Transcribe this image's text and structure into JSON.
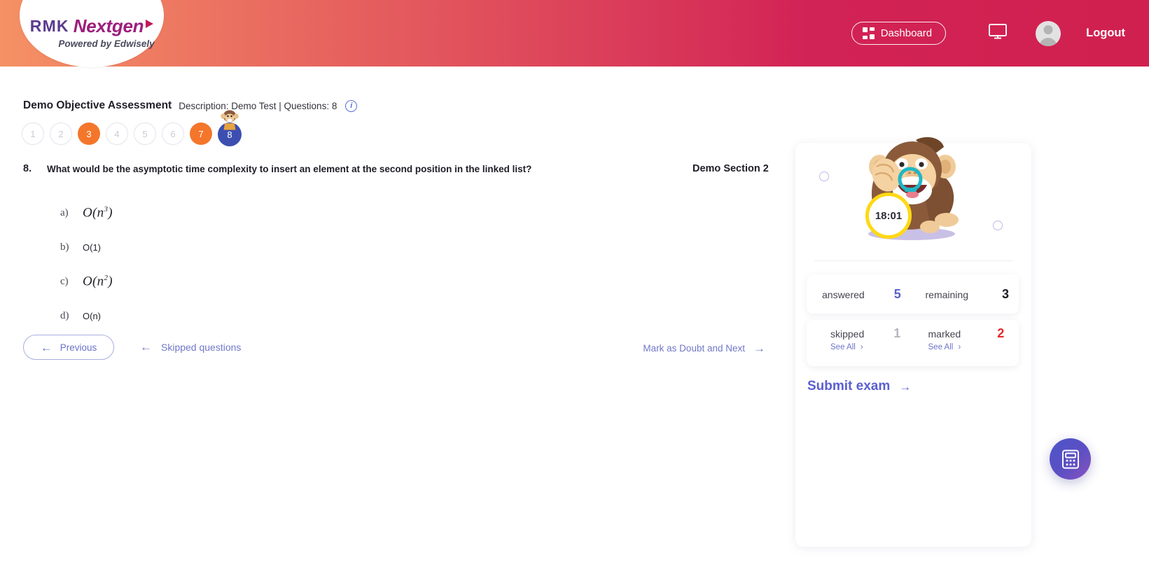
{
  "header": {
    "logo": {
      "prefix": "RMK",
      "brand": "Nextgen",
      "tagline": "Powered by Edwisely",
      "triangle_icon": "play-triangle-icon"
    },
    "dashboard_label": "Dashboard",
    "dashboard_icon": "grid-icon",
    "monitor_icon": "monitor-icon",
    "avatar_icon": "user-avatar-icon",
    "logout_label": "Logout",
    "gradient_from": "#f59164",
    "gradient_to": "#d0204f"
  },
  "assessment": {
    "title": "Demo Objective Assessment",
    "description": "Description: Demo Test | Questions: 8",
    "info_icon": "info-icon",
    "section_label": "Demo Section 2"
  },
  "question_nav": {
    "items": [
      {
        "label": "1",
        "state": "plain"
      },
      {
        "label": "2",
        "state": "plain"
      },
      {
        "label": "3",
        "state": "done"
      },
      {
        "label": "4",
        "state": "plain"
      },
      {
        "label": "5",
        "state": "plain"
      },
      {
        "label": "6",
        "state": "plain"
      },
      {
        "label": "7",
        "state": "done"
      },
      {
        "label": "8",
        "state": "current"
      }
    ],
    "mascot_icon": "monkey-mascot-icon",
    "colors": {
      "done": "#f4762a",
      "current": "#3c4fb0",
      "plain_border": "#e3e4ec"
    }
  },
  "question": {
    "number": "8.",
    "text": "What would be the asymptotic time complexity to insert an element at the second position in the linked list?",
    "options": [
      {
        "letter": "a)",
        "text": "O(n3)",
        "base": "O(n",
        "exp": "3",
        "close": ")",
        "style": "math"
      },
      {
        "letter": "b)",
        "text": "O(1)",
        "base": "O(1)",
        "exp": "",
        "close": "",
        "style": "plain"
      },
      {
        "letter": "c)",
        "text": "O(n2)",
        "base": "O(n",
        "exp": "2",
        "close": ")",
        "style": "math"
      },
      {
        "letter": "d)",
        "text": "O(n)",
        "base": "O(n)",
        "exp": "",
        "close": "",
        "style": "plain"
      }
    ]
  },
  "bottom_nav": {
    "previous_label": "Previous",
    "previous_arrow": "arrow-left-icon",
    "skipped_label": "Skipped questions",
    "skipped_arrow": "arrow-left-icon",
    "doubt_label": "Mark as Doubt and Next",
    "doubt_arrow": "arrow-right-icon"
  },
  "panel": {
    "timer": "18:01",
    "timer_ring_color": "#ffd814",
    "mascot_icon": "monkey-with-stopwatch-icon",
    "stats": [
      {
        "label": "answered",
        "value": "5",
        "color": "#5a62c8",
        "see_all": ""
      },
      {
        "label": "remaining",
        "value": "3",
        "color": "#1c1c24",
        "see_all": ""
      },
      {
        "label": "skipped",
        "value": "1",
        "color": "#b6b6bf",
        "see_all": "See All"
      },
      {
        "label": "marked",
        "value": "2",
        "color": "#e8282c",
        "see_all": "See All"
      }
    ],
    "see_all_chevron": "chevron-right-icon",
    "submit_label": "Submit exam",
    "submit_arrow": "arrow-right-icon"
  },
  "fab": {
    "icon": "calculator-icon",
    "gradient_from": "#4a56c8",
    "gradient_to": "#8a53bd"
  }
}
